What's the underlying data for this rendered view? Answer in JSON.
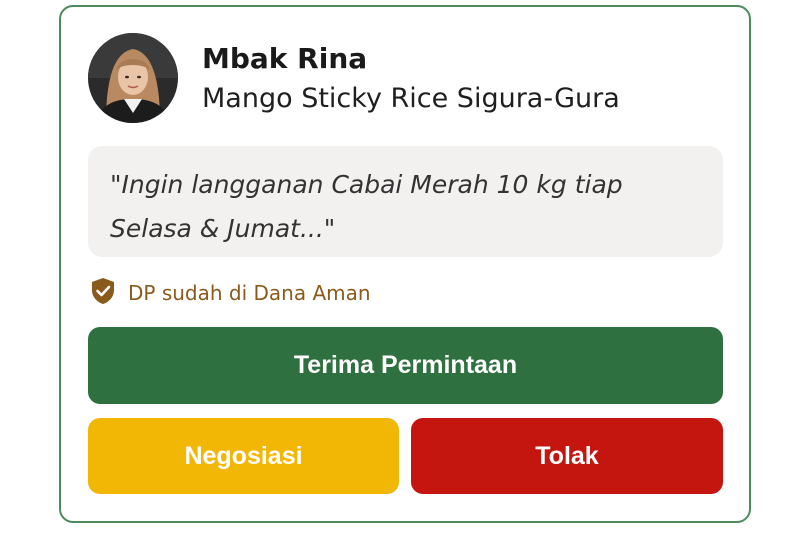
{
  "request_card": {
    "customer_name": "Mbak Rina",
    "business_name": "Mango Sticky Rice Sigura-Gura",
    "message_line1": "\"Ingin langganan Cabai Merah 10 kg tiap",
    "message_line2": "Selasa & Jumat...\"",
    "escrow_status": "DP sudah di Dana Aman",
    "icons": {
      "avatar": "user-avatar",
      "escrow": "shield-check-icon"
    }
  },
  "actions": {
    "accept_label": "Terima Permintaan",
    "negotiate_label": "Negosiasi",
    "reject_label": "Tolak"
  },
  "colors": {
    "card_border": "#4e8a5c",
    "accept": "#2f7040",
    "negotiate": "#f2b705",
    "reject": "#c4150f",
    "escrow_text": "#8a5a1c"
  }
}
